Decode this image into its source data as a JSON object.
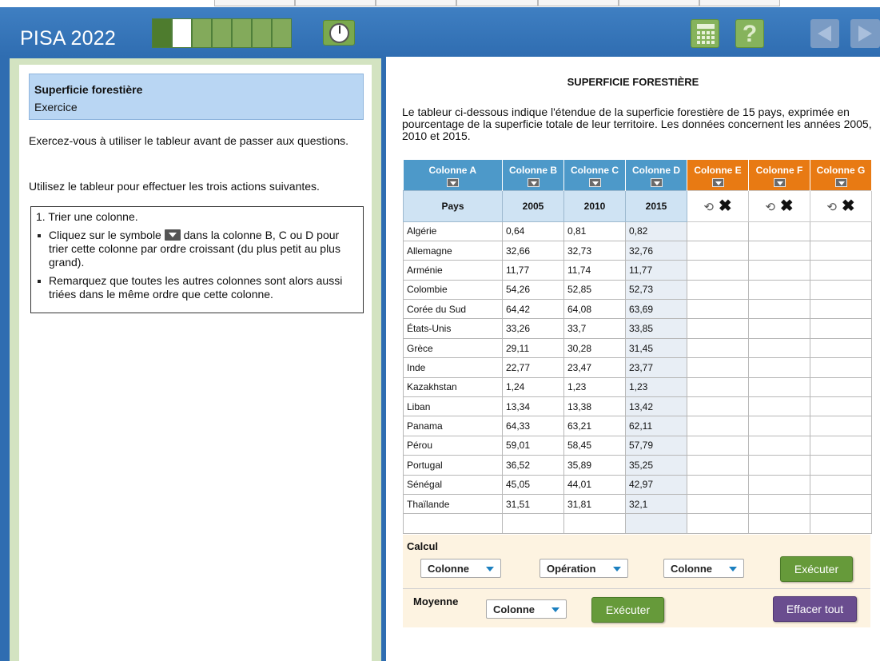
{
  "header": {
    "brand": "PISA 2022",
    "progress_segments": [
      "done",
      "current",
      "todo",
      "todo",
      "todo",
      "todo",
      "todo"
    ]
  },
  "left": {
    "task_title": "Superficie forestière",
    "task_sub": "Exercice",
    "para1": "Exercez-vous à utiliser le tableur avant de passer aux questions.",
    "para2": "Utilisez le tableur pour effectuer les trois actions suivantes.",
    "instr_title": "1. Trier une colonne.",
    "bullet1_pre": "Cliquez sur le symbole",
    "bullet1_post": "dans la colonne B, C ou D pour trier cette colonne par ordre croissant (du plus petit au plus grand).",
    "bullet2": "Remarquez que toutes les autres colonnes sont alors aussi triées dans le même ordre que cette colonne."
  },
  "right": {
    "title": "SUPERFICIE FORESTIÈRE",
    "intro": "Le tableur ci-dessous indique l'étendue de la superficie forestière de 15 pays, exprimée en pourcentage de la superficie totale de leur territoire. Les données concernent les années 2005, 2010 et 2015."
  },
  "sheet": {
    "columns": [
      {
        "label": "Colonne A",
        "color": "blue",
        "sub": "Pays"
      },
      {
        "label": "Colonne B",
        "color": "blue",
        "sub": "2005"
      },
      {
        "label": "Colonne C",
        "color": "blue",
        "sub": "2010"
      },
      {
        "label": "Colonne D",
        "color": "blue",
        "sub": "2015"
      },
      {
        "label": "Colonne E",
        "color": "orange",
        "sub": ""
      },
      {
        "label": "Colonne F",
        "color": "orange",
        "sub": ""
      },
      {
        "label": "Colonne G",
        "color": "orange",
        "sub": ""
      }
    ],
    "rows": [
      [
        "Algérie",
        "0,64",
        "0,81",
        "0,82"
      ],
      [
        "Allemagne",
        "32,66",
        "32,73",
        "32,76"
      ],
      [
        "Arménie",
        "11,77",
        "11,74",
        "11,77"
      ],
      [
        "Colombie",
        "54,26",
        "52,85",
        "52,73"
      ],
      [
        "Corée du Sud",
        "64,42",
        "64,08",
        "63,69"
      ],
      [
        "États-Unis",
        "33,26",
        "33,7",
        "33,85"
      ],
      [
        "Grèce",
        "29,11",
        "30,28",
        "31,45"
      ],
      [
        "Inde",
        "22,77",
        "23,47",
        "23,77"
      ],
      [
        "Kazakhstan",
        "1,24",
        "1,23",
        "1,23"
      ],
      [
        "Liban",
        "13,34",
        "13,38",
        "13,42"
      ],
      [
        "Panama",
        "64,33",
        "63,21",
        "62,11"
      ],
      [
        "Pérou",
        "59,01",
        "58,45",
        "57,79"
      ],
      [
        "Portugal",
        "36,52",
        "35,89",
        "35,25"
      ],
      [
        "Sénégal",
        "45,05",
        "44,01",
        "42,97"
      ],
      [
        "Thaïlande",
        "31,51",
        "31,81",
        "32,1"
      ],
      [
        "",
        "",
        "",
        ""
      ]
    ]
  },
  "calc": {
    "label": "Calcul",
    "select1": "Colonne",
    "select2": "Opération",
    "select3": "Colonne",
    "execute": "Exécuter",
    "mean_label": "Moyenne",
    "mean_select": "Colonne",
    "mean_execute": "Exécuter",
    "clear_all": "Effacer tout"
  },
  "colors": {
    "header_blue": "#2f6db1",
    "column_blue": "#4d99c9",
    "column_orange": "#e87a13",
    "button_green": "#669a3a",
    "button_purple": "#6a4d8f"
  }
}
